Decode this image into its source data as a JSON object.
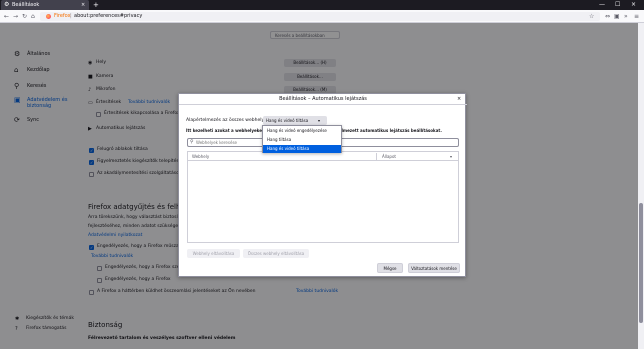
{
  "browser": {
    "tab_title": "Beállítások",
    "tab_close": "×",
    "new_tab": "+",
    "window_controls": [
      "—",
      "☐",
      "×"
    ],
    "url_brand": "Firefox",
    "url": "about:preferences#privacy",
    "nav_icons": [
      "back-icon",
      "forward-icon",
      "reload-icon",
      "home-icon",
      "bookmark-star-icon",
      "menu-icon"
    ]
  },
  "prefs_search": {
    "placeholder": "Keresés a beállításokban"
  },
  "sidebar": {
    "items": [
      {
        "label": "Általános",
        "icon": "gear-icon"
      },
      {
        "label": "Kezdőlap",
        "icon": "home-icon"
      },
      {
        "label": "Keresés",
        "icon": "search-icon"
      },
      {
        "label": "Adatvédelem és",
        "label2": "biztonság",
        "icon": "lock-icon",
        "active": true
      },
      {
        "label": "Sync",
        "icon": "sync-icon"
      }
    ],
    "bottom": [
      {
        "label": "Kiegészítők és témák",
        "icon": "puzzle-icon"
      },
      {
        "label": "Firefox támogatás",
        "icon": "help-icon"
      }
    ]
  },
  "content": {
    "permissions": [
      {
        "label": "Hely",
        "button": "Beállítások… (H)"
      },
      {
        "label": "Kamera",
        "button": "Beállítások…"
      },
      {
        "label": "Mikrofon",
        "button": "Beállítások… (M)"
      },
      {
        "label": "Értesítések",
        "link": "További tudnivalók",
        "button": "Beállítások…"
      },
      {
        "label": "Automatikus lejátszás",
        "button": "Beállítások…"
      }
    ],
    "pause_notifications": "Értesítések kikapcsolása a Firefox újraindításáig",
    "checks": [
      {
        "label": "Felugró ablakok tiltása",
        "checked": true
      },
      {
        "label": "Figyelmeztetés kiegészítők telepítésekor",
        "checked": true
      },
      {
        "label": "Az akadálymentesítési szolgáltatások",
        "checked": false
      }
    ],
    "data_heading": "Firefox adatgyűjtés és felhasználás",
    "data_text_1": "Arra törekszünk, hogy választást biztosítsunk",
    "data_text_2": "fejlesztéséhez, minden adatot szükséges. Mindig",
    "data_link": "Adatvédelmi nyilatkozat",
    "data_checks": [
      {
        "label": "Engedélyezés, hogy a Firefox műszaki",
        "checked": true
      },
      {
        "label": "Engedélyezés, hogy a Firefox szemé",
        "checked": false
      },
      {
        "label": "Engedélyezés, hogy a Firefox",
        "checked": false
      },
      {
        "label": "A Firefox a háttérben küldhet összeomlási jelentéseket az Ön nevében",
        "checked": false,
        "link": "További tudnivalók"
      }
    ],
    "more_link": "További tudnivalók",
    "security_heading": "Biztonság",
    "security_sub": "Félrevezető tartalom és veszélyes szoftver elleni védelem"
  },
  "dialog": {
    "title": "Beállítások – Automatikus lejátszás",
    "close": "×",
    "default_label": "Alapértelmezés az összes webhelyhez:",
    "selected": "Hang és videó tiltása",
    "description": "Itt kezelheti azokat a webhelyeket, amelyek nem követik az alapértelmezett automatikus lejátszás beállításokat.",
    "search_placeholder": "Webhelyek keresése",
    "col_site": "Webhely",
    "col_status": "Állapot",
    "remove_one": "Webhely eltávolítása",
    "remove_all": "Összes webhely eltávolítása",
    "cancel": "Mégse",
    "save": "Változtatások mentése"
  },
  "popup": {
    "options": [
      {
        "label": "Hang és videó engedélyezése",
        "selected": false
      },
      {
        "label": "Hang tiltása",
        "selected": false
      },
      {
        "label": "Hang és videó tiltása",
        "selected": true
      }
    ]
  }
}
